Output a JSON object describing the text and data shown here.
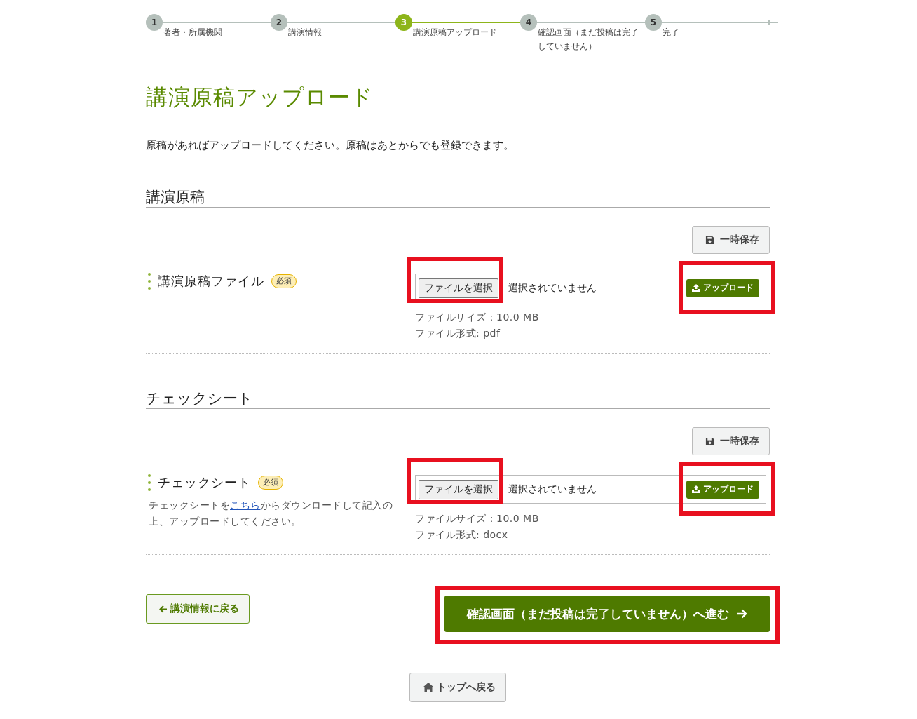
{
  "steps": [
    {
      "number": "1",
      "label": "著者・所属機関",
      "selected": false
    },
    {
      "number": "2",
      "label": "講演情報",
      "selected": false
    },
    {
      "number": "3",
      "label": "講演原稿アップロード",
      "selected": true
    },
    {
      "number": "4",
      "label": "確認画面（まだ投稿は完了していません）",
      "selected": false
    },
    {
      "number": "5",
      "label": "完了",
      "selected": false
    }
  ],
  "title": "講演原稿アップロード",
  "intro": "原稿があればアップロードしてください。原稿はあとからでも登録できます。",
  "sections": [
    {
      "heading": "講演原稿",
      "save_button": "一時保存",
      "label": "講演原稿ファイル",
      "badge": "必須",
      "file_button": "ファイルを選択",
      "file_status": "選択されていません",
      "upload_button": "アップロード",
      "info": [
        "ファイルサイズ：10.0 MB",
        "ファイル形式: pdf"
      ],
      "highlighted": true
    },
    {
      "heading": "チェックシート",
      "save_button": "一時保存",
      "label": "チェックシート",
      "badge": "必須",
      "note": {
        "before": "チェックシートを",
        "link": "こちら",
        "after": "からダウンロードして記入の上、アップロードしてください。"
      },
      "file_button": "ファイルを選択",
      "file_status": "選択されていません",
      "upload_button": "アップロード",
      "info": [
        "ファイルサイズ：10.0 MB",
        "ファイル形式: docx"
      ],
      "highlighted": true
    }
  ],
  "back_button": "講演情報に戻る",
  "next_button": {
    "label": "確認画面（まだ投稿は完了していません）へ進む",
    "highlighted": true
  },
  "top_button": "トップへ戻る"
}
